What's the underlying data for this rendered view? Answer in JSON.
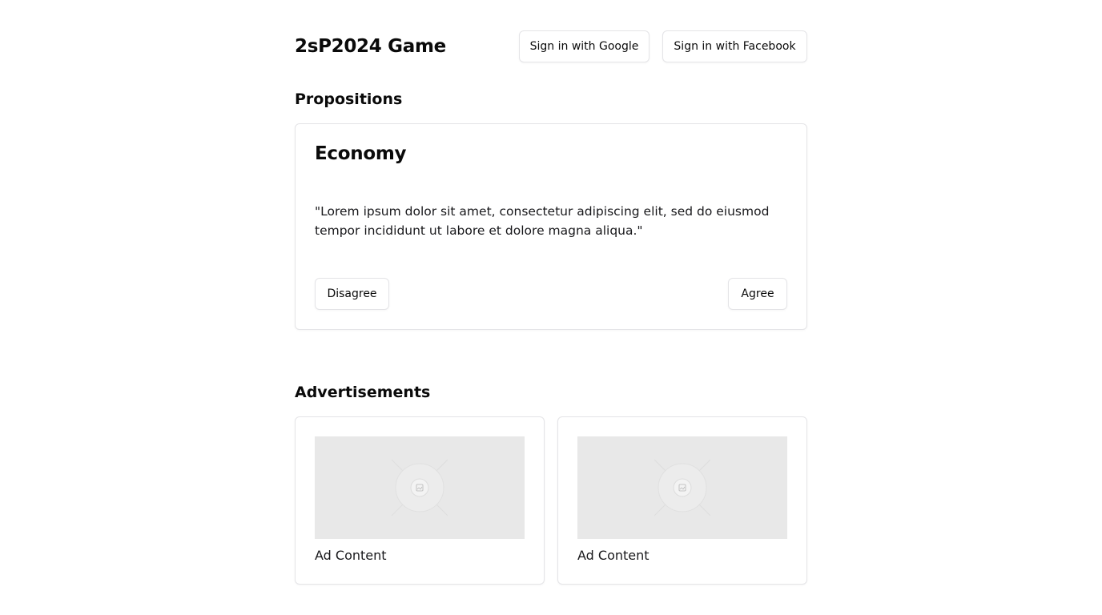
{
  "header": {
    "title": "2sP2024 Game",
    "google_button": "Sign in with Google",
    "facebook_button": "Sign in with Facebook"
  },
  "propositions": {
    "section_title": "Propositions",
    "card": {
      "title": "Economy",
      "text": "\"Lorem ipsum dolor sit amet, consectetur adipiscing elit, sed do eiusmod tempor incididunt ut labore et dolore magna aliqua.\"",
      "disagree_label": "Disagree",
      "agree_label": "Agree"
    }
  },
  "advertisements": {
    "section_title": "Advertisements",
    "items": [
      {
        "label": "Ad Content",
        "icon": "image-placeholder-icon"
      },
      {
        "label": "Ad Content",
        "icon": "image-placeholder-icon"
      }
    ]
  },
  "colors": {
    "background": "#ffffff",
    "border": "#e4e4e7",
    "text": "#0a0a0a",
    "placeholder": "#e8e8e8"
  }
}
